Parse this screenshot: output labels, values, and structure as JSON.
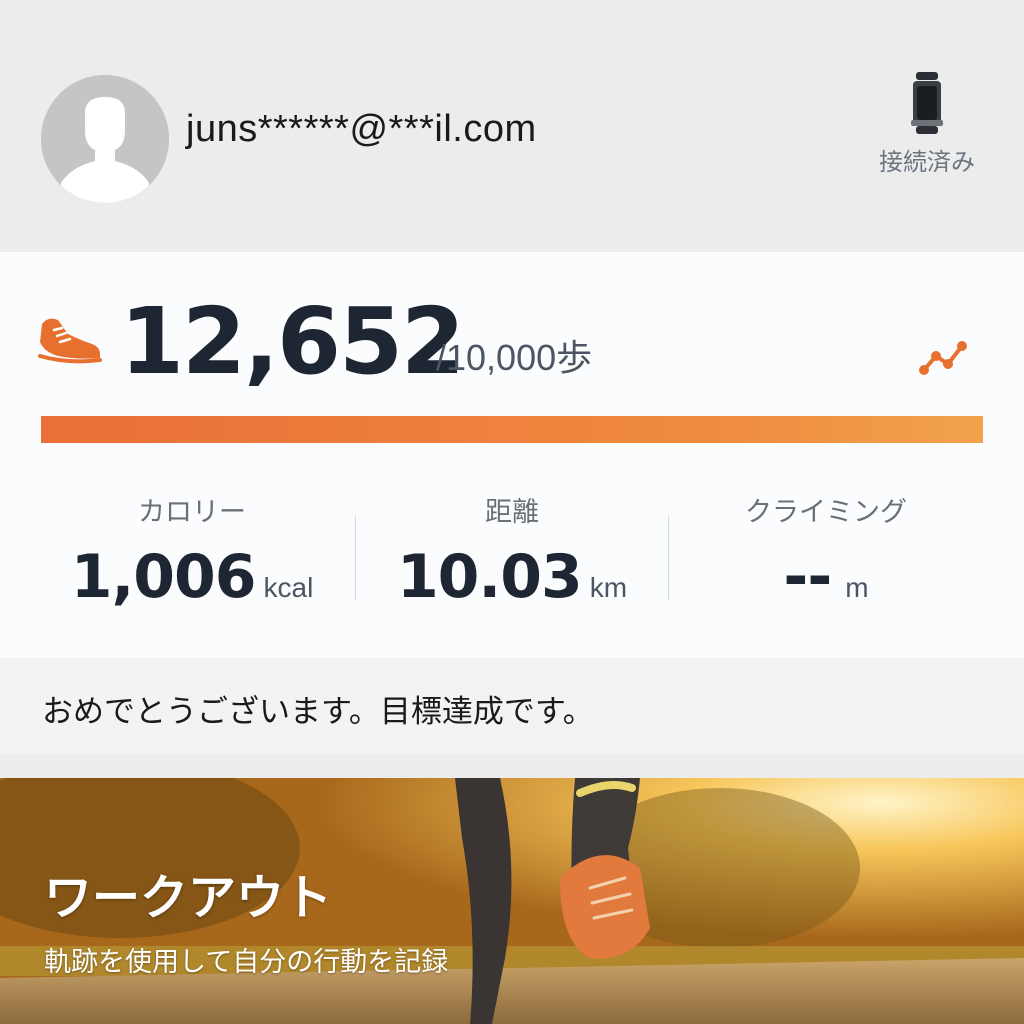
{
  "header": {
    "email": "juns******@***il.com",
    "device_status": "接続済み"
  },
  "steps": {
    "value": "12,652",
    "goal_label": "/10,000歩",
    "progress": 1.0
  },
  "stats": [
    {
      "label": "カロリー",
      "value": "1,006",
      "unit": "kcal"
    },
    {
      "label": "距離",
      "value": "10.03",
      "unit": "km"
    },
    {
      "label": "クライミング",
      "value": "--",
      "unit": "m"
    }
  ],
  "message": "おめでとうございます。目標達成です。",
  "workout": {
    "title": "ワークアウト",
    "subtitle": "軌跡を使用して自分の行動を記録"
  },
  "colors": {
    "accent": "#ea6f38",
    "progress_end": "#f1a24a",
    "text_dark": "#1f2633"
  },
  "icons": [
    "avatar",
    "band-device-icon",
    "shoe-icon",
    "trend-icon"
  ]
}
